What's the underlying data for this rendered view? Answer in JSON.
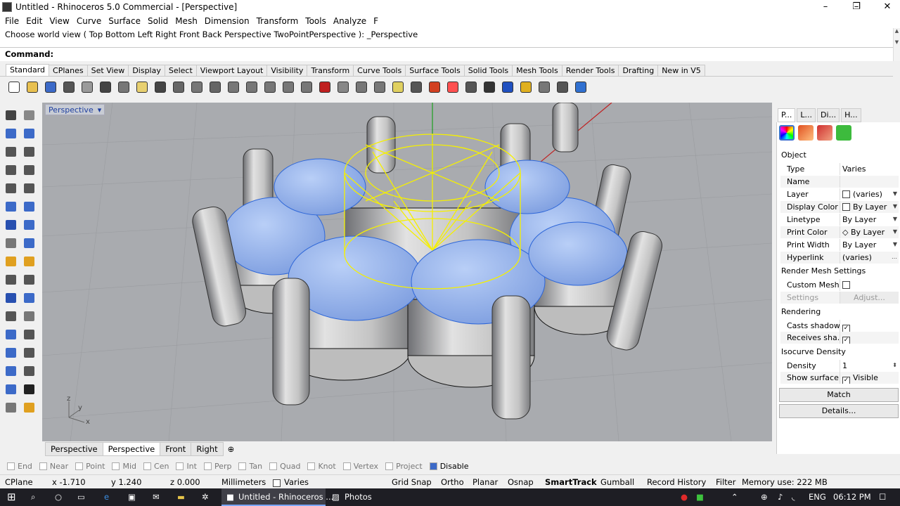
{
  "window": {
    "title": "Untitled - Rhinoceros 5.0 Commercial - [Perspective]",
    "minimize": "–",
    "maximize": "❐",
    "close": "✕"
  },
  "menu": [
    "File",
    "Edit",
    "View",
    "Curve",
    "Surface",
    "Solid",
    "Mesh",
    "Dimension",
    "Transform",
    "Tools",
    "Analyze",
    "F"
  ],
  "command": {
    "history": "Choose world view ( Top  Bottom  Left  Right  Front  Back  Perspective  TwoPointPerspective ): _Perspective",
    "prompt": "Command:"
  },
  "toolbar_tabs": [
    "Standard",
    "CPlanes",
    "Set View",
    "Display",
    "Select",
    "Viewport Layout",
    "Visibility",
    "Transform",
    "Curve Tools",
    "Surface Tools",
    "Solid Tools",
    "Mesh Tools",
    "Render Tools",
    "Drafting",
    "New in V5"
  ],
  "toolbar_icons": [
    "new-icon",
    "open-icon",
    "save-icon",
    "print-icon",
    "import-icon",
    "cut-icon",
    "copy-icon",
    "paste-icon",
    "undo-icon",
    "pan-icon",
    "move-icon",
    "zoom-icon",
    "zoom-window-icon",
    "zoom-extents-icon",
    "zoom-selected-icon",
    "rotate-view-icon",
    "four-viewports-icon",
    "car-icon",
    "tools-icon",
    "circle-icon",
    "snap-icon",
    "light-icon",
    "lock-icon",
    "layers-icon",
    "color-wheel-icon",
    "shade-icon",
    "sphere-icon",
    "render-icon",
    "highlight-icon",
    "options-icon",
    "grid-icon",
    "help-icon"
  ],
  "viewport": {
    "label": "Perspective",
    "axis_y": "y",
    "axis_z": "z",
    "axis_x": "x"
  },
  "viewport_tabs": [
    "Perspective",
    "Perspective",
    "Front",
    "Right"
  ],
  "properties": {
    "tabs": [
      "P...",
      "L...",
      "Di...",
      "H..."
    ],
    "section_object": "Object",
    "rows": [
      {
        "key": "Type",
        "value": "Varies"
      },
      {
        "key": "Name",
        "value": ""
      },
      {
        "key": "Layer",
        "value": "(varies)"
      },
      {
        "key": "Display Color",
        "value": "By Layer"
      },
      {
        "key": "Linetype",
        "value": "By Layer"
      },
      {
        "key": "Print Color",
        "value": "By Layer"
      },
      {
        "key": "Print Width",
        "value": "By Layer"
      },
      {
        "key": "Hyperlink",
        "value": "(varies)"
      }
    ],
    "section_render_mesh": "Render Mesh Settings",
    "custom_mesh": "Custom Mesh",
    "settings": "Settings",
    "adjust": "Adjust...",
    "section_rendering": "Rendering",
    "casts_shadows": "Casts shadows",
    "receives_shadows": "Receives sha...",
    "section_isocurve": "Isocurve Density",
    "density_label": "Density",
    "density_value": "1",
    "show_surface": "Show surface...",
    "visible": "Visible",
    "match_button": "Match",
    "details_button": "Details..."
  },
  "osnaps": [
    {
      "label": "End",
      "on": false
    },
    {
      "label": "Near",
      "on": false
    },
    {
      "label": "Point",
      "on": false
    },
    {
      "label": "Mid",
      "on": false
    },
    {
      "label": "Cen",
      "on": false
    },
    {
      "label": "Int",
      "on": false
    },
    {
      "label": "Perp",
      "on": false
    },
    {
      "label": "Tan",
      "on": false
    },
    {
      "label": "Quad",
      "on": false
    },
    {
      "label": "Knot",
      "on": false
    },
    {
      "label": "Vertex",
      "on": false
    },
    {
      "label": "Project",
      "on": false
    },
    {
      "label": "Disable",
      "on": true
    }
  ],
  "status": {
    "cplane": "CPlane",
    "x": "x -1.710",
    "y": "y 1.240",
    "z": "z 0.000",
    "units": "Millimeters",
    "layer": "Varies",
    "grid_snap": "Grid Snap",
    "ortho": "Ortho",
    "planar": "Planar",
    "osnap": "Osnap",
    "smarttrack": "SmartTrack",
    "gumball": "Gumball",
    "record_history": "Record History",
    "filter": "Filter",
    "memory": "Memory use: 222 MB"
  },
  "taskbar": {
    "app1": "Untitled - Rhinoceros ...",
    "app2": "Photos",
    "lang": "ENG",
    "time": "06:12 PM"
  },
  "colors": {
    "gem_blue": "#8fb2f0",
    "wire_yellow": "#f5f000",
    "viewport_bg": "#a9abaf",
    "selected_text": "#1f3fa0"
  }
}
